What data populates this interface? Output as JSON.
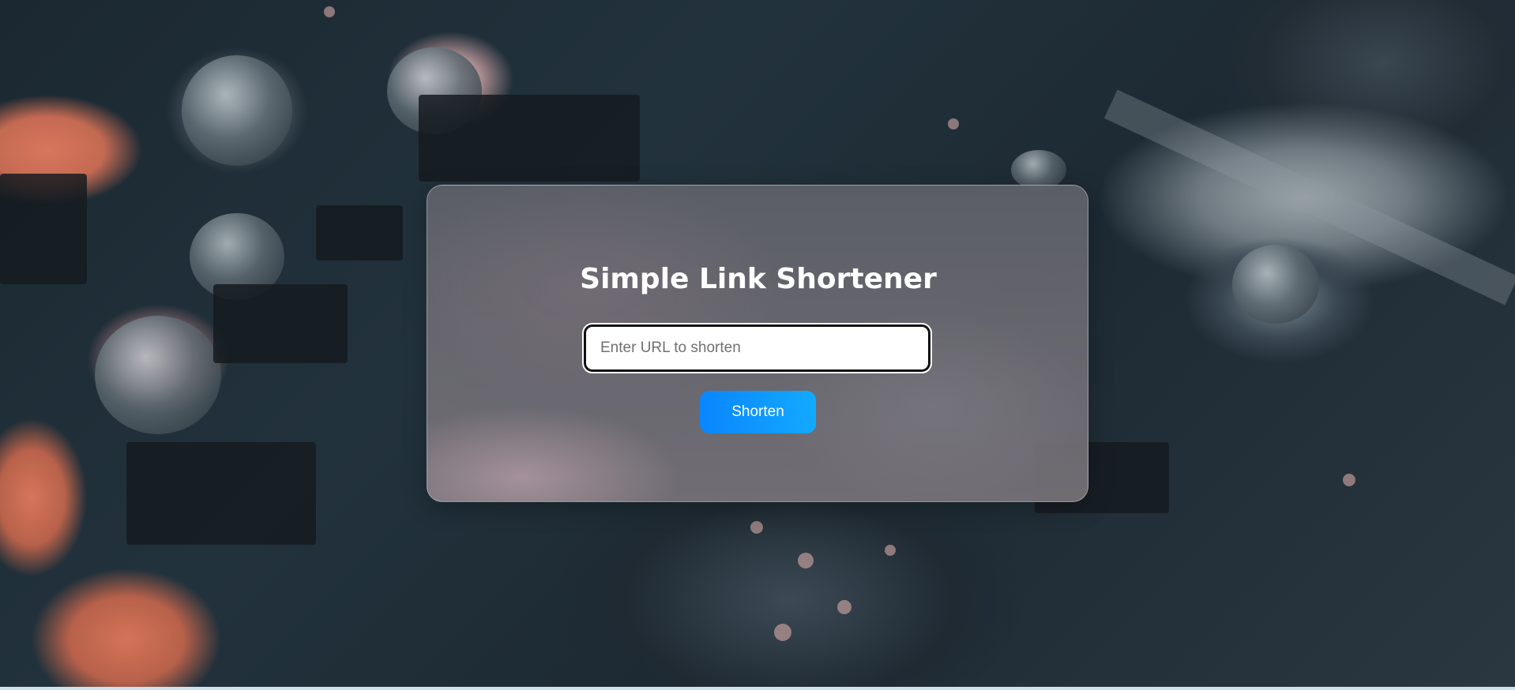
{
  "page": {
    "background_image": "circuit-board-photo"
  },
  "card": {
    "title": "Simple Link Shortener",
    "url_input": {
      "value": "",
      "placeholder": "Enter URL to shorten"
    },
    "shorten_button_label": "Shorten"
  },
  "colors": {
    "button_gradient_start": "#0a86ff",
    "button_gradient_end": "#13a9ff",
    "title_color": "#ffffff"
  }
}
